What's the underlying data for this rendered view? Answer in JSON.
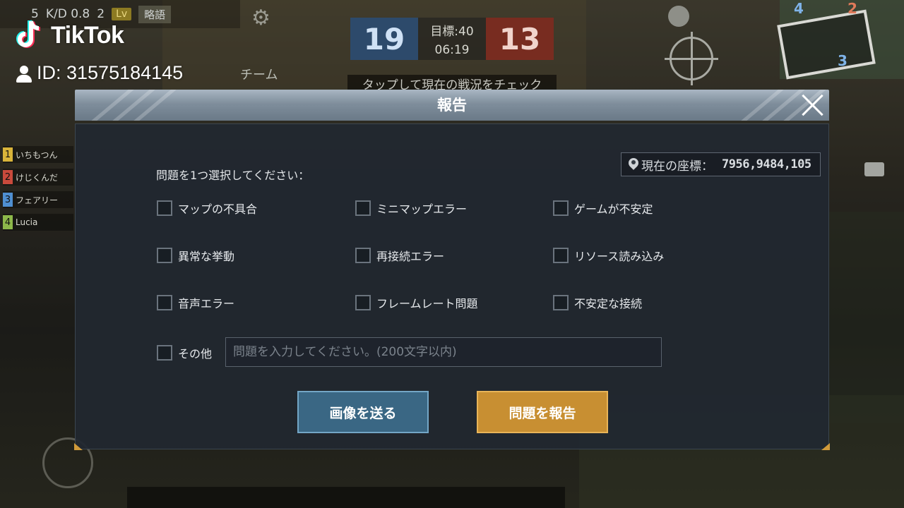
{
  "watermark": {
    "brand": "TikTok",
    "user_id": "ID: 31575184145"
  },
  "hud": {
    "stats": {
      "kills": "5",
      "kd": "K/D 0.8",
      "assists": "2",
      "team_tag": "略語"
    },
    "team_label": "チーム",
    "score": {
      "blue": "19",
      "target": "目標:40",
      "time": "06:19",
      "red": "13"
    },
    "tap_banner": "タップして現在の戦況をチェック",
    "players": [
      {
        "rank": "1",
        "name": "いちもつん",
        "color": "#d9b43a"
      },
      {
        "rank": "2",
        "name": "けじくんだ",
        "color": "#c94a3c"
      },
      {
        "rank": "3",
        "name": "フェアリー",
        "color": "#4f8fd1"
      },
      {
        "rank": "4",
        "name": "Lucia",
        "color": "#8db84a"
      }
    ],
    "minimap_numbers": [
      "4",
      "2",
      "3"
    ]
  },
  "dialog": {
    "title": "報告",
    "coords_label": "現在の座標：",
    "coords_value": "7956,9484,105",
    "prompt": "問題を1つ選択してください：",
    "options": [
      "マップの不具合",
      "ミニマップエラー",
      "ゲームが不安定",
      "異常な挙動",
      "再接続エラー",
      "リソース読み込み",
      "音声エラー",
      "フレームレート問題",
      "不安定な接続"
    ],
    "other_label": "その他",
    "other_placeholder": "問題を入力してください。(200文字以内)",
    "send_image_label": "画像を送る",
    "report_label": "問題を報告"
  }
}
